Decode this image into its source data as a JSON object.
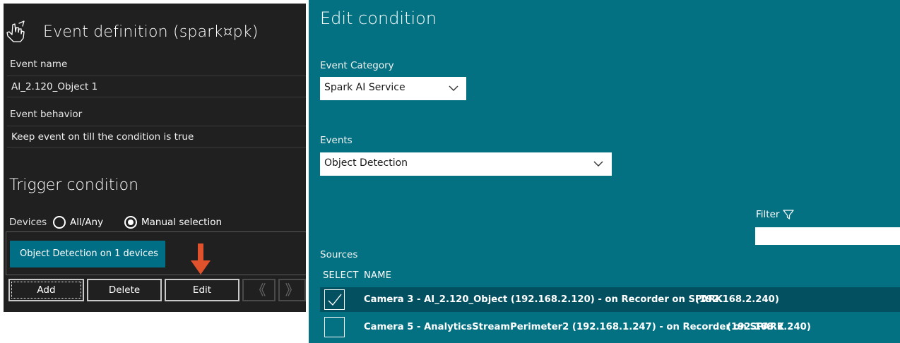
{
  "event_definition": {
    "title": "Event definition (spark¤pk)",
    "event_name_label": "Event name",
    "event_name_value": "AI_2.120_Object 1",
    "event_behavior_label": "Event behavior",
    "event_behavior_value": "Keep event on till the condition is true",
    "trigger_title": "Trigger condition",
    "devices_label": "Devices",
    "radio_all_any": "All/Any",
    "radio_manual": "Manual selection",
    "selected_radio": "Manual selection",
    "device_chip": "Object Detection on 1 devices",
    "buttons": {
      "add": "Add",
      "delete": "Delete",
      "edit": "Edit",
      "prev": "《",
      "next": "》"
    },
    "annotation_arrow_color": "#e0522b"
  },
  "edit_condition": {
    "title": "Edit condition",
    "event_category_label": "Event Category",
    "event_category_value": "Spark AI Service",
    "events_label": "Events",
    "events_value": "Object Detection",
    "filter_label": "Filter",
    "filter_value": "",
    "sources_label": "Sources",
    "columns": {
      "select": "SELECT",
      "name": "NAME"
    },
    "sources": [
      {
        "selected": true,
        "name": "Camera 3 - AI_2.120_Object (192.168.2.120) - on Recorder on SPARK",
        "recorder_ip": "(192.168.2.240)"
      },
      {
        "selected": false,
        "name": "Camera 5 - AnalyticsStreamPerimeter2 (192.168.1.247) - on Recorder on SPARK",
        "recorder_ip": "(192.168.2.240)"
      }
    ]
  },
  "colors": {
    "left_bg": "#202020",
    "right_bg": "#047183",
    "selected_row": "#035061",
    "chip_bg": "#006e85"
  }
}
